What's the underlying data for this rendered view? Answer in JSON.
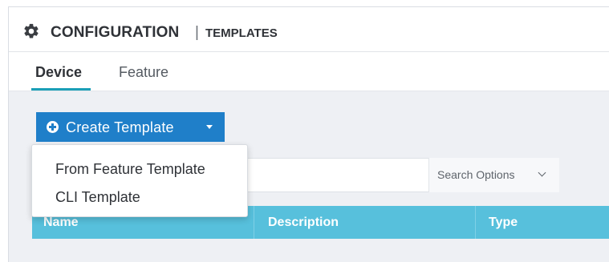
{
  "header": {
    "title": "CONFIGURATION",
    "separator": "|",
    "subtitle": "TEMPLATES",
    "icon": "gear-icon"
  },
  "tabs": [
    {
      "label": "Device",
      "active": true
    },
    {
      "label": "Feature",
      "active": false
    }
  ],
  "toolbar": {
    "create_button_label": "Create Template",
    "create_button_icon": "plus-circle-icon",
    "create_button_caret": "caret-down-icon",
    "dropdown_items": [
      {
        "label": "From Feature Template"
      },
      {
        "label": "CLI Template"
      }
    ]
  },
  "search": {
    "value": "",
    "options_label": "Search Options",
    "options_icon": "chevron-down-icon"
  },
  "table": {
    "columns": [
      "Name",
      "Description",
      "Type"
    ]
  },
  "colors": {
    "accent": "#1f7fc9",
    "table_header": "#57c0dc",
    "tab_indicator": "#1b9fb7"
  }
}
